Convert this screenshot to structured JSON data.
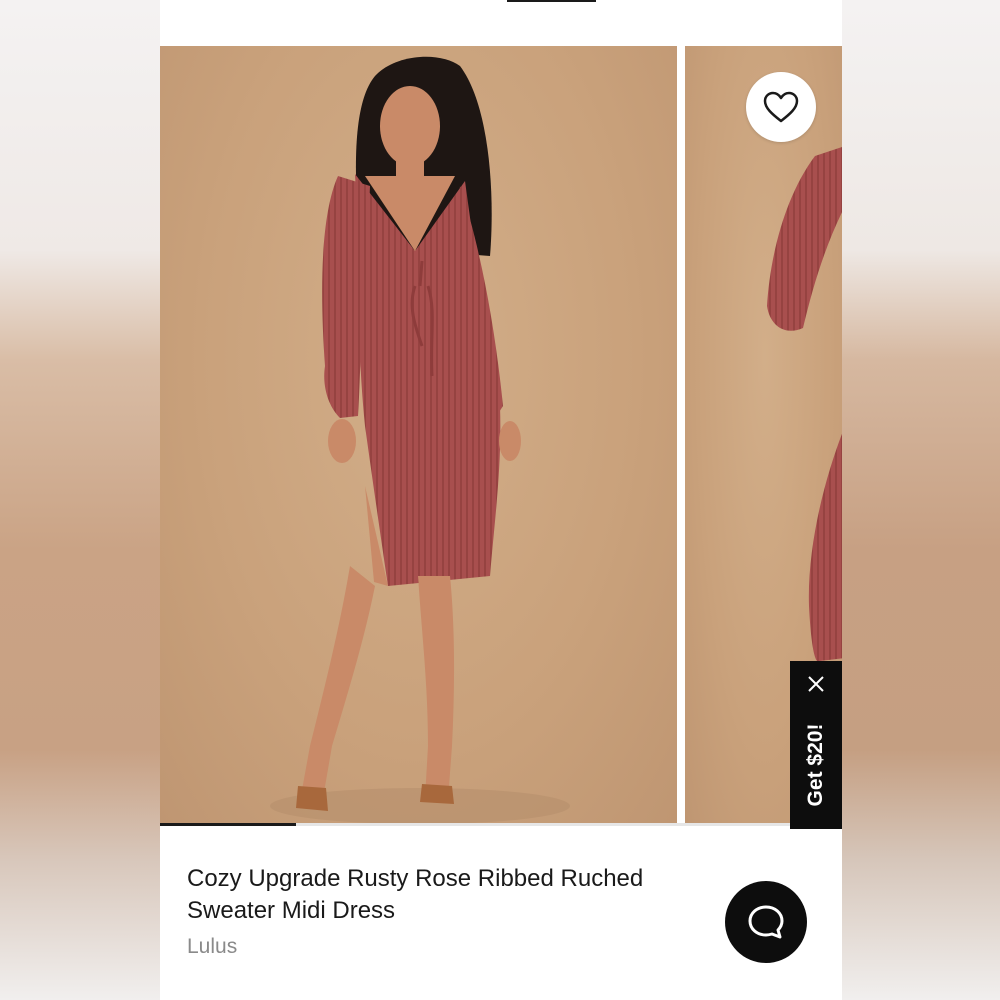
{
  "product": {
    "title_line1": "Cozy Upgrade Rusty Rose Ribbed Ruched",
    "title_line2": "Sweater Midi Dress",
    "brand": "Lulus"
  },
  "carousel": {
    "progress": 0.2,
    "photo_colors": {
      "backdrop": "#c9a17b",
      "dress": "#a84f4e",
      "skin": "#c98a68",
      "hair": "#1e1613",
      "heels": "#a8683c"
    }
  },
  "wishlist": {
    "icon": "heart-outline-icon"
  },
  "promo": {
    "label": "Get $20!",
    "close_icon": "close-icon"
  },
  "chat": {
    "icon": "chat-bubble-icon"
  },
  "theme": {
    "accent": "#0d0d0d",
    "text": "#1a1a1a",
    "muted": "#8a8a8a"
  }
}
